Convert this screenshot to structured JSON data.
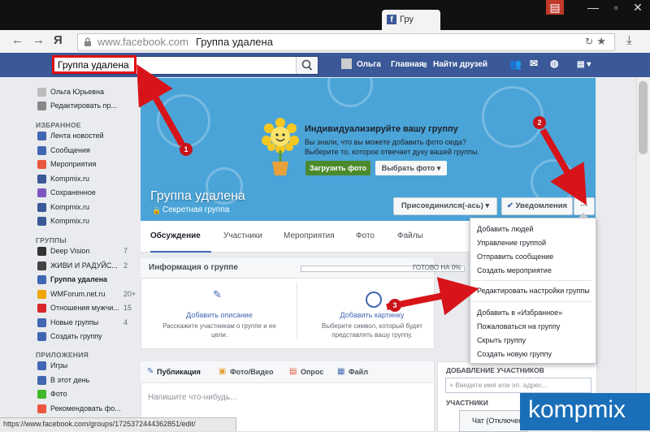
{
  "browser": {
    "tab_title": "Гру",
    "url_domain": "www.facebook.com",
    "page_title": "Группа удалена"
  },
  "topbar": {
    "search_value": "Группа удалена",
    "user": "Ольга",
    "home": "Главная",
    "home_badge": "8",
    "find_friends": "Найти друзей"
  },
  "sidebar": {
    "profile_name": "Ольга Юрьевна",
    "edit_profile": "Редактировать пр...",
    "favorites_header": "ИЗБРАННОЕ",
    "favorites": [
      {
        "label": "Лента новостей",
        "color": "#4267b2"
      },
      {
        "label": "Сообщения",
        "color": "#4267b2"
      },
      {
        "label": "Мероприятия",
        "color": "#e9573f"
      },
      {
        "label": "Kompmix.ru",
        "color": "#3b5998"
      },
      {
        "label": "Сохраненное",
        "color": "#7e57c2"
      },
      {
        "label": "Kompmix.ru",
        "color": "#3b5998"
      },
      {
        "label": "Kompmix.ru",
        "color": "#3b5998"
      }
    ],
    "groups_header": "ГРУППЫ",
    "groups": [
      {
        "label": "Deep Vision",
        "count": "7",
        "color": "#333"
      },
      {
        "label": "ЖИВИ И РАДУЙС...",
        "count": "2",
        "color": "#444"
      },
      {
        "label": "Группа удалена",
        "count": "",
        "color": "#4267b2"
      },
      {
        "label": "WMForum.net.ru",
        "count": "20+",
        "color": "#f0a500"
      },
      {
        "label": "Отношения мужчи...",
        "count": "15",
        "color": "#d9262c"
      },
      {
        "label": "Новые группы",
        "count": "4",
        "color": "#4267b2"
      },
      {
        "label": "Создать группу",
        "count": "",
        "color": "#4267b2"
      }
    ],
    "apps_header": "ПРИЛОЖЕНИЯ",
    "apps": [
      {
        "label": "Игры",
        "color": "#4267b2"
      },
      {
        "label": "В этот день",
        "color": "#4267b2"
      },
      {
        "label": "Фото",
        "color": "#42b72a"
      },
      {
        "label": "Рекомендовать фо...",
        "color": "#e9573f"
      }
    ]
  },
  "cover": {
    "promo_title": "Индивидуализируйте вашу группу",
    "promo_text": "Вы знали, что вы можете добавить фото сюда? Выберите то, которое отвечает духу вашей группы.",
    "upload_button": "Загрузить фото",
    "choose_button": "Выбрать фото ▾",
    "group_name": "Группа удалена",
    "group_type": "Секретная группа",
    "joined_button": "Присоединился(-ась) ▾",
    "notifications_button": "Уведомления",
    "more_button": "···"
  },
  "tabs": [
    "Обсуждение",
    "Участники",
    "Мероприятия",
    "Фото",
    "Файлы"
  ],
  "dropdown": {
    "items_group1": [
      "Добавить людей",
      "Управление группой",
      "Отправить сообщение",
      "Создать мероприятие"
    ],
    "items_group2": [
      "Редактировать настройки группы"
    ],
    "items_group3": [
      "Добавить в «Избранное»",
      "Пожаловаться на группу",
      "Скрыть группу",
      "Создать новую группу"
    ]
  },
  "info": {
    "title": "Информация о группе",
    "progress_label": "ГОТОВО НА 0%",
    "progress": 0,
    "add_description_title": "Добавить описание",
    "add_description_text": "Расскажите участникам о группе и ее цели.",
    "add_picture_title": "Добавить картинку",
    "add_picture_text": "Выберите символ, который будет представлять вашу группу."
  },
  "publisher": {
    "tabs": [
      "Публикация",
      "Фото/Видео",
      "Опрос",
      "Файл"
    ],
    "placeholder": "Напишите что-нибудь..."
  },
  "right": {
    "add_members_header": "ДОБАВЛЕНИЕ УЧАСТНИКОВ",
    "add_members_placeholder": "+ Введите имя или эл. адрес...",
    "members_header": "УЧАСТНИКИ"
  },
  "status": {
    "url": "https://www.facebook.com/groups/1725372444362851/edit/",
    "chat": "Чат (Отключен)"
  },
  "annotations": [
    "1",
    "2",
    "3"
  ],
  "watermark": "kompmix",
  "colors": {
    "fb_blue": "#3b5998",
    "arrow_red": "#d7141a",
    "cover": "#4aa4d8"
  }
}
